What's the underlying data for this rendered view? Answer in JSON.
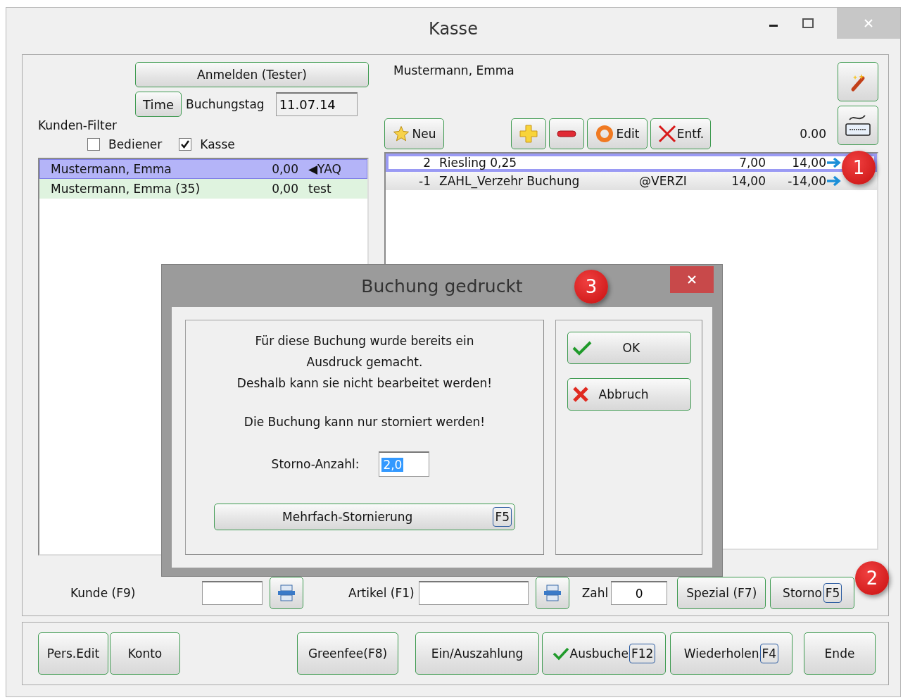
{
  "window": {
    "title": "Kasse"
  },
  "login_button": {
    "label": "Anmelden (Tester)"
  },
  "time_button": {
    "label": "Time"
  },
  "booking_day": {
    "label": "Buchungstag",
    "value": "11.07.14"
  },
  "customer_filter": {
    "title": "Kunden-Filter",
    "options": [
      {
        "label": "Bediener",
        "checked": false
      },
      {
        "label": "Kasse",
        "checked": true
      }
    ]
  },
  "customers": [
    {
      "name": "Mustermann, Emma",
      "balance": "0,00",
      "note": "◀YAQ",
      "selected": true,
      "color": "#b4b4f8"
    },
    {
      "name": "Mustermann, Emma (35)",
      "balance": "0,00",
      "note": "test",
      "selected": false,
      "color": "#dff3df"
    }
  ],
  "current_customer": "Mustermann, Emma",
  "toolbar": [
    {
      "kind": "star",
      "label": "Neu"
    },
    {
      "kind": "plus"
    },
    {
      "kind": "minus"
    },
    {
      "kind": "ring",
      "label": "Edit"
    },
    {
      "kind": "cross",
      "label": "Entf."
    }
  ],
  "total": "0.00",
  "bookings": [
    {
      "qty": "2",
      "item": "Riesling 0,25",
      "price": "7,00",
      "amount": "14,00",
      "selected": true
    },
    {
      "qty": "-1",
      "item": "ZAHL_Verzehr Buchung",
      "code": "@VERZI",
      "price": "14,00",
      "amount": "-14,00",
      "selected": false
    }
  ],
  "entry_row": {
    "customer": {
      "label": "Kunde (F9)"
    },
    "article": {
      "label": "Artikel (F1)"
    },
    "count": {
      "label": "Zahl",
      "value": "0"
    },
    "buttons": [
      {
        "label": "Spezial (F7)"
      },
      {
        "label": "Storno",
        "key": "F5"
      }
    ]
  },
  "footer_buttons": [
    {
      "label": "Pers.Edit"
    },
    {
      "label": "Konto"
    },
    {
      "label": "Greenfee(F8)"
    },
    {
      "label": "Ein/Auszahlung"
    },
    {
      "label": "Ausbuche",
      "key": "F12",
      "kind": "check"
    },
    {
      "label": "Wiederholen",
      "key": "F4"
    },
    {
      "label": "Ende"
    }
  ],
  "dialog": {
    "title": "Buchung gedruckt",
    "message": [
      "Für diese Buchung wurde bereits ein",
      "Ausdruck gemacht.",
      "Deshalb kann sie nicht bearbeitet werden!"
    ],
    "note": "Die Buchung kann nur storniert werden!",
    "storno_count": {
      "label": "Storno-Anzahl:",
      "value": "2,0"
    },
    "multi_button": {
      "label": "Mehrfach-Stornierung",
      "key": "F5"
    },
    "buttons": [
      {
        "kind": "ok",
        "label": "OK"
      },
      {
        "kind": "cancel",
        "label": "Abbruch"
      }
    ]
  },
  "markers": [
    {
      "label": "1"
    },
    {
      "label": "2"
    },
    {
      "label": "3"
    }
  ]
}
